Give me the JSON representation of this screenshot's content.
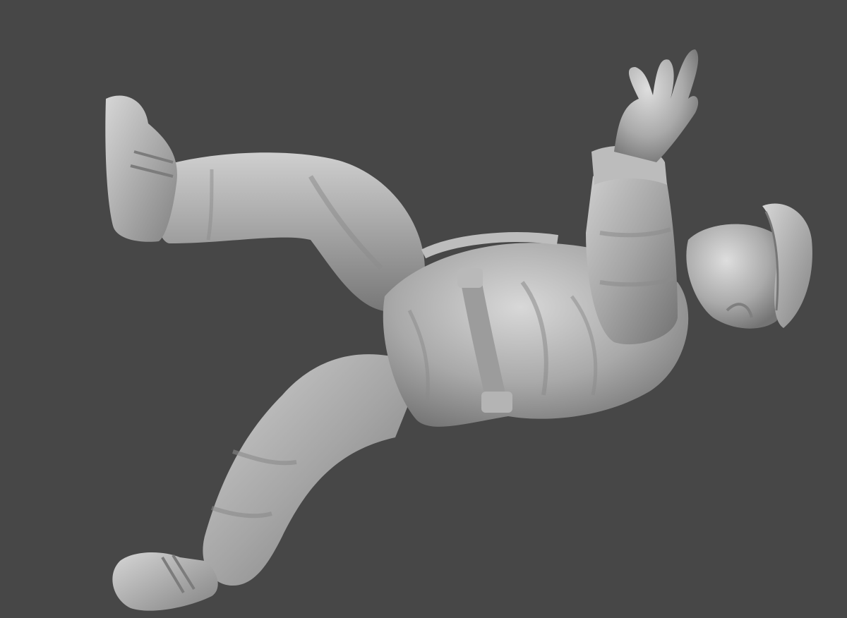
{
  "viewport": {
    "background_color": "#474747",
    "model_color": "#a9a9a9",
    "model_highlight": "#d4d4d4",
    "model_shadow": "#6e6e6e"
  }
}
